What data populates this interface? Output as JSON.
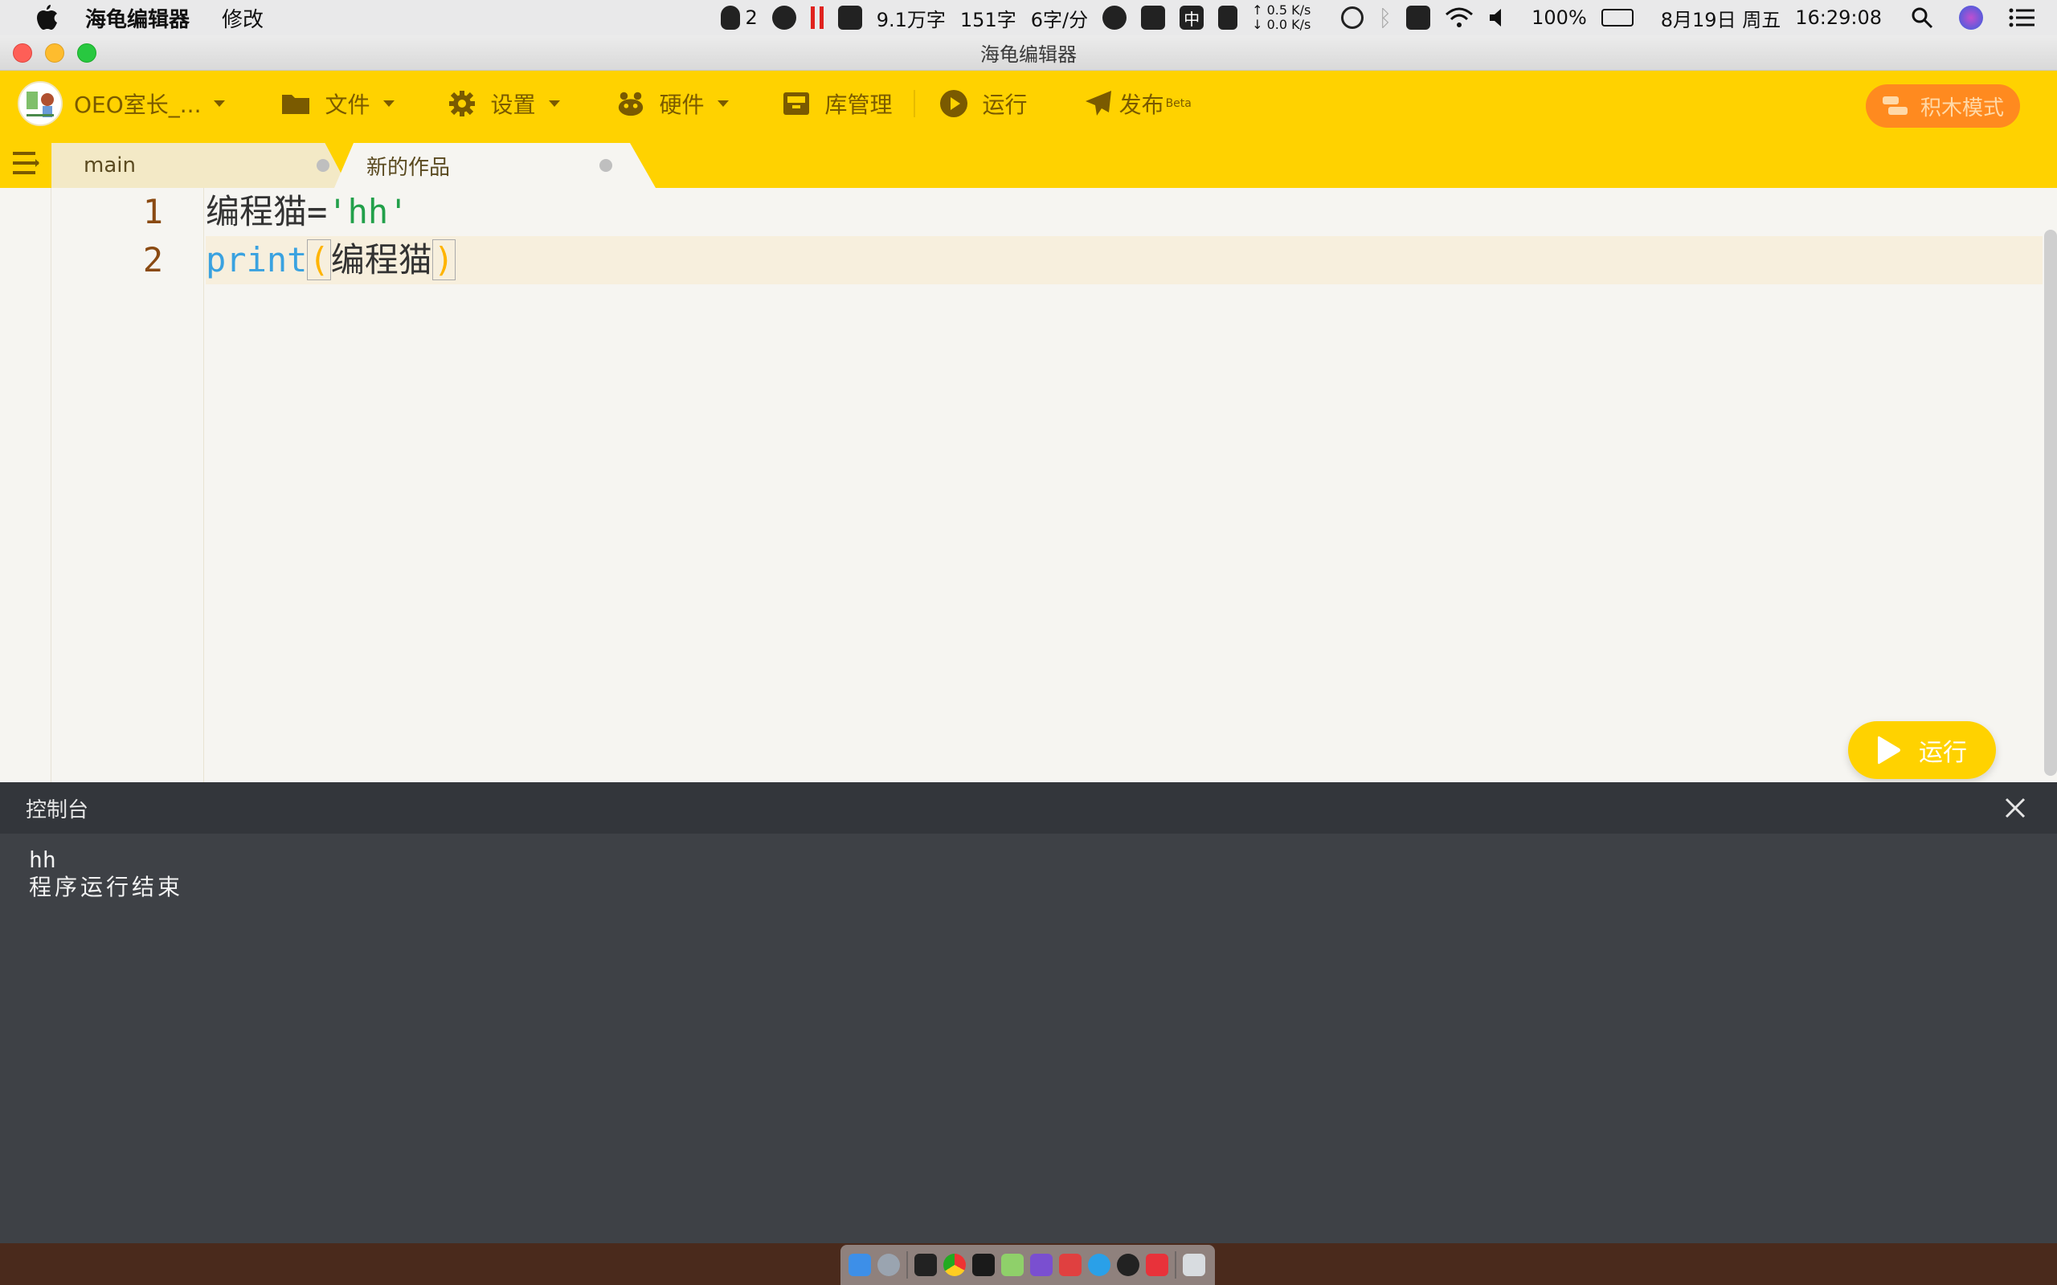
{
  "menubar": {
    "app_name": "海龟编辑器",
    "menu_edit": "修改",
    "qq_count": "2",
    "word_total": "9.1万字",
    "word_today": "151字",
    "word_speed": "6字/分",
    "ime_label": "中",
    "net_up": "↑ 0.5 K/s",
    "net_down": "↓ 0.0 K/s",
    "battery": "100%",
    "date": "8月19日 周五",
    "time": "16:29:08"
  },
  "window": {
    "title": "海龟编辑器"
  },
  "toolbar": {
    "user": "OEO室长_...",
    "file": "文件",
    "settings": "设置",
    "hardware": "硬件",
    "library": "库管理",
    "run": "运行",
    "publish": "发布",
    "publish_beta": "Beta",
    "block_mode": "积木模式"
  },
  "tabs": [
    {
      "label": "main"
    },
    {
      "label": "新的作品"
    }
  ],
  "editor": {
    "line_numbers": [
      "1",
      "2"
    ],
    "line1": {
      "var": "编程猫",
      "op": "=",
      "str": "'hh'"
    },
    "line2": {
      "kw": "print",
      "open": "(",
      "arg": "编程猫",
      "close": ")"
    },
    "run_button": "运行"
  },
  "console": {
    "title": "控制台",
    "output": [
      "hh",
      "程序运行结束"
    ]
  },
  "colors": {
    "toolbar_yellow": "#ffd200",
    "block_mode_orange": "#ff8a1f",
    "console_bg": "#3e4146",
    "keyword_blue": "#3aa2e0",
    "string_green": "#22a04a"
  }
}
